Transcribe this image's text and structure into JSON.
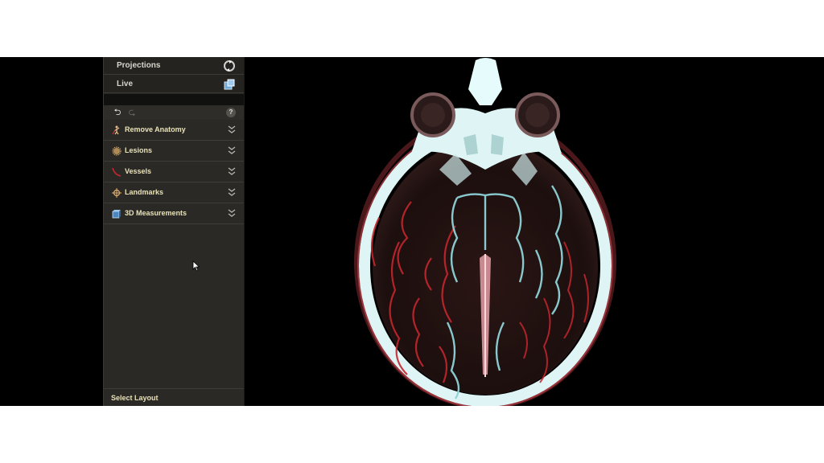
{
  "views": [
    {
      "label": "Projections",
      "icon": "projections-icon"
    },
    {
      "label": "Live",
      "icon": "live-icon"
    }
  ],
  "toolbar": {
    "undo_icon": "undo-icon",
    "redo_icon": "redo-icon",
    "help_label": "?"
  },
  "tools": [
    {
      "label": "Remove Anatomy",
      "icon": "remove-anatomy-icon"
    },
    {
      "label": "Lesions",
      "icon": "lesions-icon"
    },
    {
      "label": "Vessels",
      "icon": "vessels-icon"
    },
    {
      "label": "Landmarks",
      "icon": "landmarks-icon"
    },
    {
      "label": "3D Measurements",
      "icon": "3d-measurements-icon"
    }
  ],
  "footer": {
    "select_layout_label": "Select Layout"
  },
  "colors": {
    "panel_bg": "#2a2926",
    "tool_label": "#e9e2b8",
    "vessel_red": "#c4262e",
    "vessel_cyan": "#8fd3d8",
    "skull": "#dff5f5"
  }
}
